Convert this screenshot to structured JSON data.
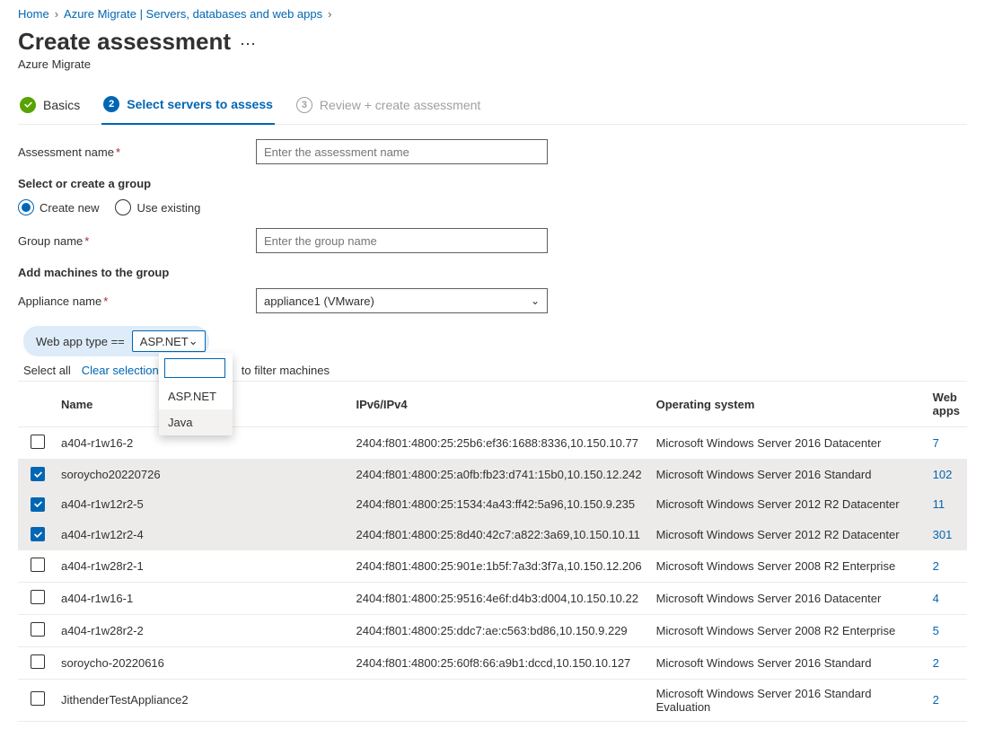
{
  "breadcrumb": {
    "home": "Home",
    "path1": "Azure Migrate | Servers, databases and web apps"
  },
  "title": "Create assessment",
  "subtitle": "Azure Migrate",
  "steps": {
    "s1": "Basics",
    "s2": "Select servers to assess",
    "s3": "Review + create assessment",
    "n2": "2",
    "n3": "3"
  },
  "labels": {
    "assessment_name": "Assessment name",
    "select_or_create": "Select or create a group",
    "create_new": "Create new",
    "use_existing": "Use existing",
    "group_name": "Group name",
    "add_machines": "Add machines to the group",
    "appliance_name": "Appliance name",
    "webapp_type": "Web app type  ==",
    "select_all": "Select all",
    "clear_selection": "Clear selection",
    "filter_hint": "to filter machines"
  },
  "placeholders": {
    "assessment": "Enter the assessment name",
    "group": "Enter the group name"
  },
  "appliance_value": "appliance1 (VMware)",
  "pill_value": "ASP.NET",
  "dropdown_options": [
    "ASP.NET",
    "Java"
  ],
  "table": {
    "headers": {
      "name": "Name",
      "ip": "IPv6/IPv4",
      "os": "Operating system",
      "apps": "Web apps"
    },
    "rows": [
      {
        "sel": false,
        "name": "a404-r1w16-2",
        "ip": "2404:f801:4800:25:25b6:ef36:1688:8336,10.150.10.77",
        "os": "Microsoft Windows Server 2016 Datacenter",
        "apps": "7"
      },
      {
        "sel": true,
        "name": "soroycho20220726",
        "ip": "2404:f801:4800:25:a0fb:fb23:d741:15b0,10.150.12.242",
        "os": "Microsoft Windows Server 2016 Standard",
        "apps": "102"
      },
      {
        "sel": true,
        "name": "a404-r1w12r2-5",
        "ip": "2404:f801:4800:25:1534:4a43:ff42:5a96,10.150.9.235",
        "os": "Microsoft Windows Server 2012 R2 Datacenter",
        "apps": "11"
      },
      {
        "sel": true,
        "name": "a404-r1w12r2-4",
        "ip": "2404:f801:4800:25:8d40:42c7:a822:3a69,10.150.10.11",
        "os": "Microsoft Windows Server 2012 R2 Datacenter",
        "apps": "301"
      },
      {
        "sel": false,
        "name": "a404-r1w28r2-1",
        "ip": "2404:f801:4800:25:901e:1b5f:7a3d:3f7a,10.150.12.206",
        "os": "Microsoft Windows Server 2008 R2 Enterprise",
        "apps": "2"
      },
      {
        "sel": false,
        "name": "a404-r1w16-1",
        "ip": "2404:f801:4800:25:9516:4e6f:d4b3:d004,10.150.10.22",
        "os": "Microsoft Windows Server 2016 Datacenter",
        "apps": "4"
      },
      {
        "sel": false,
        "name": "a404-r1w28r2-2",
        "ip": "2404:f801:4800:25:ddc7:ae:c563:bd86,10.150.9.229",
        "os": "Microsoft Windows Server 2008 R2 Enterprise",
        "apps": "5"
      },
      {
        "sel": false,
        "name": "soroycho-20220616",
        "ip": "2404:f801:4800:25:60f8:66:a9b1:dccd,10.150.10.127",
        "os": "Microsoft Windows Server 2016 Standard",
        "apps": "2"
      },
      {
        "sel": false,
        "name": "JithenderTestAppliance2",
        "ip": "",
        "os": "Microsoft Windows Server 2016 Standard Evaluation",
        "apps": "2"
      }
    ]
  }
}
